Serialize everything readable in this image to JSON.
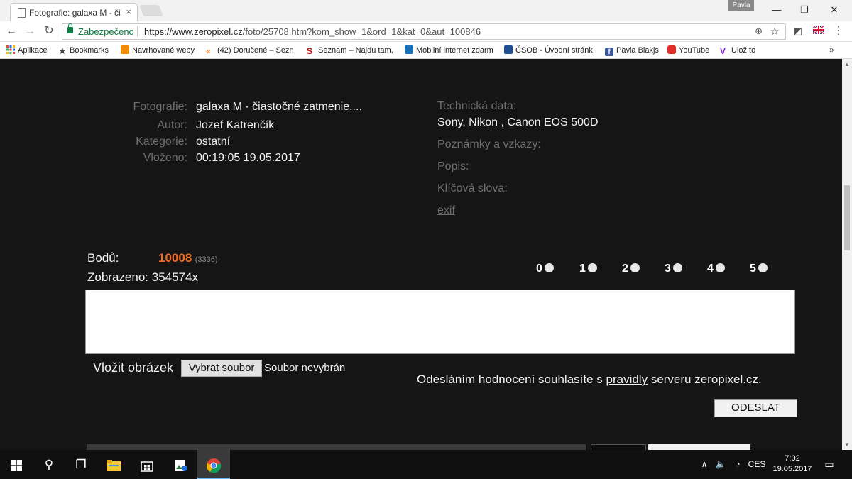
{
  "browser": {
    "tab_title": "Fotografie: galaxa M - čia",
    "tab_close": "×",
    "profile_name": "Pavla",
    "window_controls": [
      "—",
      "❐",
      "✕"
    ],
    "secure_label": "Zabezpečeno",
    "url_host": "https://www.zeropixel.cz",
    "url_path": "/foto/25708.htm?kom_show=1&ord=1&kat=0&aut=100846",
    "bookmarks": [
      {
        "label": "Aplikace",
        "icon": "apps-grid-icon",
        "color": "#e8453c"
      },
      {
        "label": "Bookmarks",
        "icon": "star-icon",
        "color": "#444444"
      },
      {
        "label": "Navrhované weby",
        "icon": "orange-page-icon",
        "color": "#f28b00"
      },
      {
        "label": "(42) Doručené – Sezn",
        "icon": "email-icon",
        "color": "#e86a1f"
      },
      {
        "label": "Seznam – Najdu tam,",
        "icon": "seznam-icon",
        "color": "#cc0000"
      },
      {
        "label": "Mobilní internet zdarm",
        "icon": "mobile-icon",
        "color": "#1a6fb7"
      },
      {
        "label": "ČSOB - Úvodní stránk",
        "icon": "csob-icon",
        "color": "#1d4f91"
      },
      {
        "label": "Pavla Blakjs",
        "icon": "facebook-icon",
        "color": "#3b5998"
      },
      {
        "label": "YouTube",
        "icon": "youtube-icon",
        "color": "#e52d27"
      },
      {
        "label": "Ulož.to",
        "icon": "ulozto-icon",
        "color": "#8a2be2"
      }
    ],
    "bookmarks_more": "»"
  },
  "photo": {
    "labels": {
      "photo": "Fotografie:",
      "author": "Autor:",
      "category": "Kategorie:",
      "inserted": "Vloženo:"
    },
    "title": "galaxa M - čiastočné zatmenie....",
    "author": "Jozef Katrenčík",
    "category": "ostatní",
    "inserted": "00:19:05 19.05.2017"
  },
  "technical": {
    "tech_label": "Technická data:",
    "tech_value": "Sony, Nikon , Canon EOS 500D",
    "notes_label": "Poznámky a vzkazy:",
    "desc_label": "Popis:",
    "keywords_label": "Klíčová slova:",
    "exif_link": "exif"
  },
  "stats": {
    "points_label": "Bodů:",
    "points_value": "10008",
    "points_sub": "(3336)",
    "views_label": "Zobrazeno:",
    "views_value": "354574x"
  },
  "rating": [
    "0",
    "1",
    "2",
    "3",
    "4",
    "5"
  ],
  "form": {
    "insert_image_label": "Vložit obrázek",
    "choose_file_button": "Vybrat soubor",
    "no_file_text": "Soubor nevybrán",
    "agree_prefix": "Odesláním hodnocení souhlasíte s ",
    "agree_link": "pravidly",
    "agree_suffix": " serveru zeropixel.cz.",
    "send_button": "ODESLAT"
  },
  "taskbar": {
    "language": "CES",
    "time": "7:02",
    "date": "19.05.2017"
  }
}
